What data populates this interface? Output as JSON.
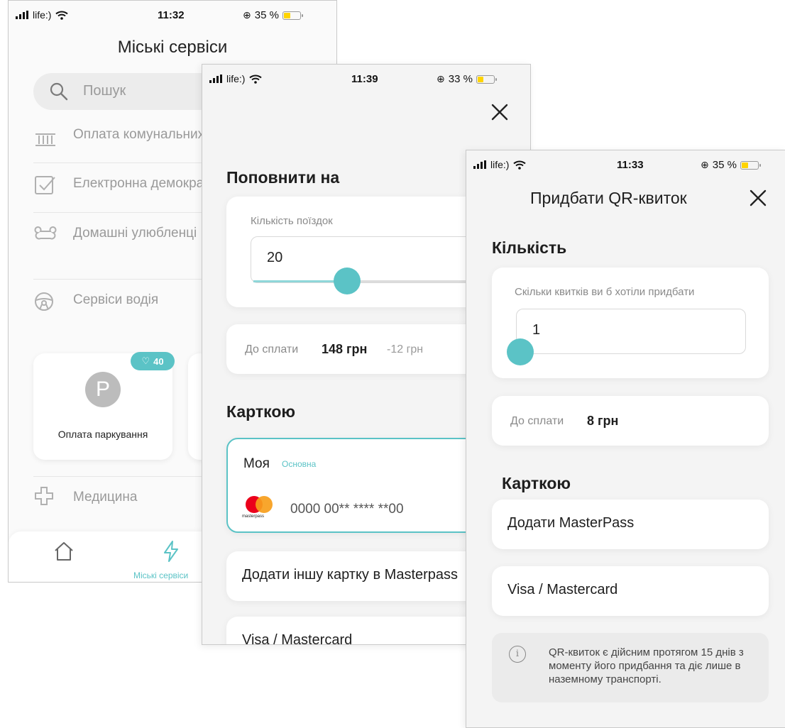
{
  "screen1": {
    "status": {
      "carrier": "life:)",
      "time": "11:32",
      "battery": "35 %"
    },
    "title": "Міські сервіси",
    "search_placeholder": "Пошук",
    "menu": [
      {
        "label": "Оплата комунальних",
        "icon": "bank-icon"
      },
      {
        "label": "Електронна демократія",
        "icon": "checkbox-icon"
      },
      {
        "label": "Домашні улюбленці",
        "icon": "bone-icon"
      },
      {
        "label": "Сервіси водія",
        "icon": "steering-wheel-icon"
      }
    ],
    "parking_card": {
      "badge_count": "40",
      "icon_letter": "P",
      "label": "Оплата паркування"
    },
    "medicine_label": "Медицина",
    "nav": {
      "active_label": "Міські сервіси"
    }
  },
  "screen2": {
    "status": {
      "carrier": "life:)",
      "time": "11:39",
      "battery": "33 %"
    },
    "heading_topup": "Поповнити на",
    "trips_label": "Кількість поїздок",
    "trips_value": "20",
    "trips_slider_fraction": 0.35,
    "pay_label": "До сплати",
    "pay_amount": "148 грн",
    "discount": "-12 грн",
    "heading_card": "Карткою",
    "selected_card": {
      "name": "Моя",
      "tag": "Основна",
      "number": "0000 00** **** **00",
      "brand": "masterpass"
    },
    "add_card_label": "Додати іншу картку в Masterpass",
    "visa_label": "Visa / Mastercard",
    "accent_color": "#5bc3c6"
  },
  "screen3": {
    "status": {
      "carrier": "life:)",
      "time": "11:33",
      "battery": "35 %"
    },
    "title": "Придбати QR-квиток",
    "heading_qty": "Кількість",
    "qty_label": "Скільки квитків ви б хотіли придбати",
    "qty_value": "1",
    "qty_slider_fraction": 0.0,
    "pay_label": "До сплати",
    "pay_amount": "8 грн",
    "heading_card": "Карткою",
    "add_masterpass_label": "Додати MasterPass",
    "visa_label": "Visa / Mastercard",
    "info_text": "QR-квиток є дійсним протягом 15 днів з моменту його придбання та діє лише в наземному транспорті."
  }
}
